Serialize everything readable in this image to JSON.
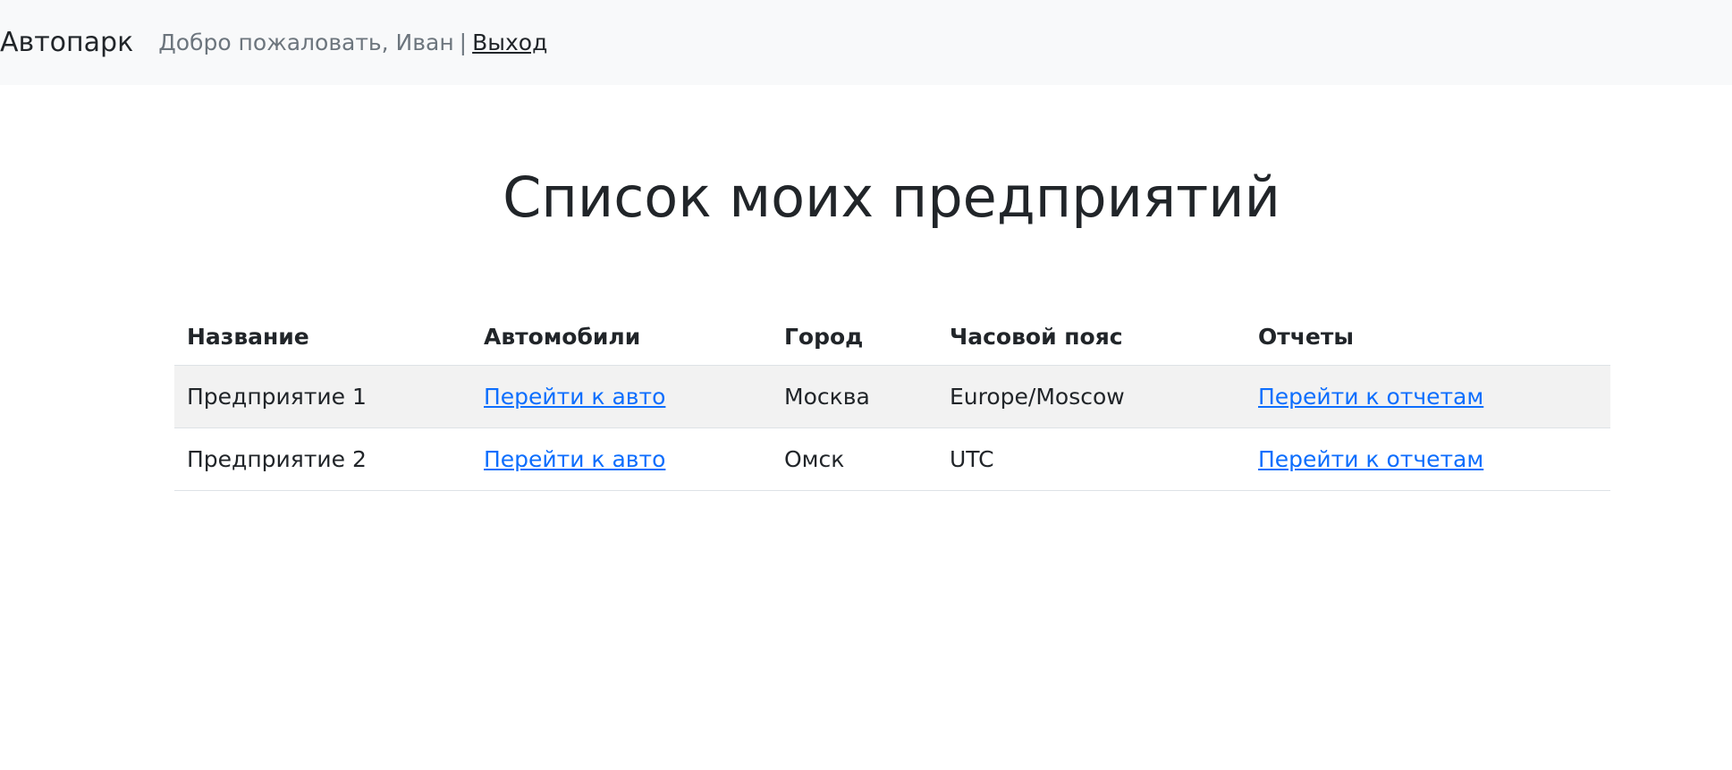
{
  "navbar": {
    "brand": "Автопарк",
    "welcome": "Добро пожаловать, Иван",
    "separator": "|",
    "logout": "Выход"
  },
  "main": {
    "title": "Список моих предприятий",
    "table": {
      "headers": [
        "Название",
        "Автомобили",
        "Город",
        "Часовой пояс",
        "Отчеты"
      ],
      "rows": [
        {
          "name": "Предприятие 1",
          "cars_link": "Перейти к авто",
          "city": "Москва",
          "timezone": "Europe/Moscow",
          "reports_link": "Перейти к отчетам"
        },
        {
          "name": "Предприятие 2",
          "cars_link": "Перейти к авто",
          "city": "Омск",
          "timezone": "UTC",
          "reports_link": "Перейти к отчетам"
        }
      ]
    }
  },
  "colors": {
    "navbar_bg": "#f8f9fa",
    "link": "#0d6efd",
    "stripe": "#f2f2f2"
  }
}
